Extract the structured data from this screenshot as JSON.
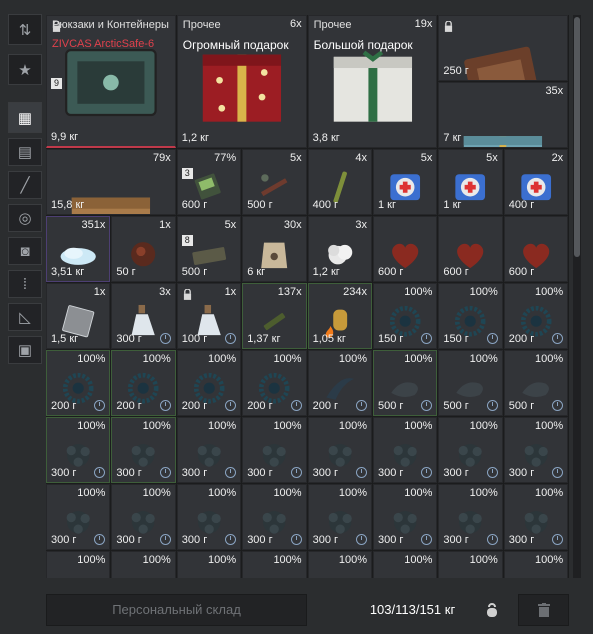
{
  "sidebar": {
    "items": [
      {
        "name": "sort-icon",
        "active": false
      },
      {
        "name": "favorite-star-icon",
        "active": false
      },
      {
        "name": "all-items-grid-icon",
        "active": true
      },
      {
        "name": "armor-icon",
        "active": false
      },
      {
        "name": "weapon-icon",
        "active": false
      },
      {
        "name": "grenade-icon",
        "active": false
      },
      {
        "name": "device-icon",
        "active": false
      },
      {
        "name": "ammo-icon",
        "active": false
      },
      {
        "name": "tools-icon",
        "active": false
      },
      {
        "name": "container-icon",
        "active": false
      }
    ]
  },
  "items": [
    {
      "col": 0,
      "row": 0,
      "w": 2,
      "h": 2,
      "cat": "Рюкзаки и Контейнеры",
      "name": "ZIVCAS ArcticSafe-6",
      "name_color": "red",
      "weight": "9,9 кг",
      "count": "",
      "badge": "9",
      "lock": true,
      "rare": true,
      "art": "safe"
    },
    {
      "col": 2,
      "row": 0,
      "w": 2,
      "h": 2,
      "cat": "Прочее",
      "name": "Огромный подарок",
      "weight": "1,2 кг",
      "count": "6x",
      "art": "gift-red"
    },
    {
      "col": 4,
      "row": 0,
      "w": 2,
      "h": 2,
      "cat": "Прочее",
      "name": "Большой подарок",
      "weight": "3,8 кг",
      "count": "19x",
      "art": "gift-white"
    },
    {
      "col": 6,
      "row": 0,
      "w": 2,
      "h": 1,
      "weight": "250 г",
      "count": "",
      "lock": true,
      "art": "case"
    },
    {
      "col": 6,
      "row": 1,
      "w": 2,
      "h": 1,
      "weight": "7 кг",
      "count": "35x",
      "art": "gift-blue"
    },
    {
      "col": 0,
      "row": 2,
      "w": 2,
      "h": 1,
      "weight": "15,8 кг",
      "count": "79x",
      "art": "box"
    },
    {
      "col": 2,
      "row": 2,
      "w": 1,
      "h": 1,
      "weight": "600 г",
      "count": "77%",
      "badge": "3",
      "art": "device"
    },
    {
      "col": 3,
      "row": 2,
      "w": 1,
      "h": 1,
      "weight": "500 г",
      "count": "5x",
      "art": "grenade"
    },
    {
      "col": 4,
      "row": 2,
      "w": 1,
      "h": 1,
      "weight": "400 г",
      "count": "4x",
      "art": "stick"
    },
    {
      "col": 5,
      "row": 2,
      "w": 1,
      "h": 1,
      "weight": "1 кг",
      "count": "5x",
      "art": "medkit"
    },
    {
      "col": 6,
      "row": 2,
      "w": 1,
      "h": 1,
      "weight": "1 кг",
      "count": "5x",
      "art": "medkit"
    },
    {
      "col": 7,
      "row": 2,
      "w": 1,
      "h": 1,
      "weight": "400 г",
      "count": "2x",
      "art": "medkit"
    },
    {
      "col": 0,
      "row": 3,
      "w": 1,
      "h": 1,
      "weight": "3,51 кг",
      "count": "351x",
      "art": "snow",
      "purple": true
    },
    {
      "col": 1,
      "row": 3,
      "w": 1,
      "h": 1,
      "weight": "50 г",
      "count": "1x",
      "art": "shard"
    },
    {
      "col": 2,
      "row": 3,
      "w": 1,
      "h": 1,
      "weight": "500 г",
      "count": "5x",
      "badge": "8",
      "art": "brick"
    },
    {
      "col": 3,
      "row": 3,
      "w": 1,
      "h": 1,
      "weight": "6 кг",
      "count": "30x",
      "art": "bag"
    },
    {
      "col": 4,
      "row": 3,
      "w": 1,
      "h": 1,
      "weight": "1,2 кг",
      "count": "3x",
      "art": "cloud"
    },
    {
      "col": 5,
      "row": 3,
      "w": 1,
      "h": 1,
      "weight": "600 г",
      "count": "",
      "art": "heart"
    },
    {
      "col": 6,
      "row": 3,
      "w": 1,
      "h": 1,
      "weight": "600 г",
      "count": "",
      "art": "heart"
    },
    {
      "col": 7,
      "row": 3,
      "w": 1,
      "h": 1,
      "weight": "600 г",
      "count": "",
      "art": "heart"
    },
    {
      "col": 0,
      "row": 4,
      "w": 1,
      "h": 1,
      "weight": "1,5 кг",
      "count": "1x",
      "art": "plate"
    },
    {
      "col": 1,
      "row": 4,
      "w": 1,
      "h": 1,
      "weight": "300 г",
      "count": "3x",
      "art": "bottle",
      "clock": true
    },
    {
      "col": 2,
      "row": 4,
      "w": 1,
      "h": 1,
      "weight": "100 г",
      "count": "1x",
      "art": "bottle",
      "lock": true,
      "clock": true
    },
    {
      "col": 3,
      "row": 4,
      "w": 1,
      "h": 1,
      "weight": "1,37 кг",
      "count": "137x",
      "art": "ammo",
      "green": true
    },
    {
      "col": 4,
      "row": 4,
      "w": 1,
      "h": 1,
      "weight": "1,05 кг",
      "count": "234x",
      "art": "ammo-fire",
      "green": true
    },
    {
      "col": 5,
      "row": 4,
      "w": 1,
      "h": 1,
      "weight": "150 г",
      "count": "100%",
      "art": "artifact",
      "clock": true
    },
    {
      "col": 6,
      "row": 4,
      "w": 1,
      "h": 1,
      "weight": "150 г",
      "count": "100%",
      "art": "artifact",
      "clock": true
    },
    {
      "col": 7,
      "row": 4,
      "w": 1,
      "h": 1,
      "weight": "200 г",
      "count": "100%",
      "art": "artifact",
      "clock": true
    },
    {
      "col": 0,
      "row": 5,
      "w": 1,
      "h": 1,
      "weight": "200 г",
      "count": "100%",
      "art": "artifact",
      "clock": true,
      "green": true
    },
    {
      "col": 1,
      "row": 5,
      "w": 1,
      "h": 1,
      "weight": "200 г",
      "count": "100%",
      "art": "artifact",
      "clock": true,
      "green": true
    },
    {
      "col": 2,
      "row": 5,
      "w": 1,
      "h": 1,
      "weight": "200 г",
      "count": "100%",
      "art": "artifact",
      "clock": true
    },
    {
      "col": 3,
      "row": 5,
      "w": 1,
      "h": 1,
      "weight": "200 г",
      "count": "100%",
      "art": "artifact",
      "clock": true
    },
    {
      "col": 4,
      "row": 5,
      "w": 1,
      "h": 1,
      "weight": "200 г",
      "count": "100%",
      "art": "claw",
      "clock": true
    },
    {
      "col": 5,
      "row": 5,
      "w": 1,
      "h": 1,
      "weight": "500 г",
      "count": "100%",
      "art": "dark",
      "clock": true,
      "green": true
    },
    {
      "col": 6,
      "row": 5,
      "w": 1,
      "h": 1,
      "weight": "500 г",
      "count": "100%",
      "art": "dark",
      "clock": true
    },
    {
      "col": 7,
      "row": 5,
      "w": 1,
      "h": 1,
      "weight": "500 г",
      "count": "100%",
      "art": "dark",
      "clock": true
    },
    {
      "col": 0,
      "row": 6,
      "w": 1,
      "h": 1,
      "weight": "300 г",
      "count": "100%",
      "art": "flower",
      "clock": true,
      "green": true
    },
    {
      "col": 1,
      "row": 6,
      "w": 1,
      "h": 1,
      "weight": "300 г",
      "count": "100%",
      "art": "flower",
      "clock": true,
      "green": true
    },
    {
      "col": 2,
      "row": 6,
      "w": 1,
      "h": 1,
      "weight": "300 г",
      "count": "100%",
      "art": "flower",
      "clock": true
    },
    {
      "col": 3,
      "row": 6,
      "w": 1,
      "h": 1,
      "weight": "300 г",
      "count": "100%",
      "art": "flower",
      "clock": true
    },
    {
      "col": 4,
      "row": 6,
      "w": 1,
      "h": 1,
      "weight": "300 г",
      "count": "100%",
      "art": "flower",
      "clock": true
    },
    {
      "col": 5,
      "row": 6,
      "w": 1,
      "h": 1,
      "weight": "300 г",
      "count": "100%",
      "art": "flower",
      "clock": true
    },
    {
      "col": 6,
      "row": 6,
      "w": 1,
      "h": 1,
      "weight": "300 г",
      "count": "100%",
      "art": "flower",
      "clock": true
    },
    {
      "col": 7,
      "row": 6,
      "w": 1,
      "h": 1,
      "weight": "300 г",
      "count": "100%",
      "art": "flower",
      "clock": true
    },
    {
      "col": 0,
      "row": 7,
      "w": 1,
      "h": 1,
      "weight": "300 г",
      "count": "100%",
      "art": "flower",
      "clock": true
    },
    {
      "col": 1,
      "row": 7,
      "w": 1,
      "h": 1,
      "weight": "300 г",
      "count": "100%",
      "art": "flower",
      "clock": true
    },
    {
      "col": 2,
      "row": 7,
      "w": 1,
      "h": 1,
      "weight": "300 г",
      "count": "100%",
      "art": "flower",
      "clock": true
    },
    {
      "col": 3,
      "row": 7,
      "w": 1,
      "h": 1,
      "weight": "300 г",
      "count": "100%",
      "art": "flower",
      "clock": true
    },
    {
      "col": 4,
      "row": 7,
      "w": 1,
      "h": 1,
      "weight": "300 г",
      "count": "100%",
      "art": "flower",
      "clock": true
    },
    {
      "col": 5,
      "row": 7,
      "w": 1,
      "h": 1,
      "weight": "300 г",
      "count": "100%",
      "art": "flower",
      "clock": true
    },
    {
      "col": 6,
      "row": 7,
      "w": 1,
      "h": 1,
      "weight": "300 г",
      "count": "100%",
      "art": "flower",
      "clock": true
    },
    {
      "col": 7,
      "row": 7,
      "w": 1,
      "h": 1,
      "weight": "300 г",
      "count": "100%",
      "art": "flower",
      "clock": true
    },
    {
      "col": 0,
      "row": 8,
      "w": 1,
      "h": 1,
      "weight": "",
      "count": "100%",
      "art": "flower"
    },
    {
      "col": 1,
      "row": 8,
      "w": 1,
      "h": 1,
      "weight": "",
      "count": "100%",
      "art": "flower"
    },
    {
      "col": 2,
      "row": 8,
      "w": 1,
      "h": 1,
      "weight": "",
      "count": "100%",
      "art": "flower"
    },
    {
      "col": 3,
      "row": 8,
      "w": 1,
      "h": 1,
      "weight": "",
      "count": "100%",
      "art": "flower"
    },
    {
      "col": 4,
      "row": 8,
      "w": 1,
      "h": 1,
      "weight": "",
      "count": "100%",
      "art": "flower"
    },
    {
      "col": 5,
      "row": 8,
      "w": 1,
      "h": 1,
      "weight": "",
      "count": "100%",
      "art": "flower"
    },
    {
      "col": 6,
      "row": 8,
      "w": 1,
      "h": 1,
      "weight": "",
      "count": "100%",
      "art": "flower"
    },
    {
      "col": 7,
      "row": 8,
      "w": 1,
      "h": 1,
      "weight": "",
      "count": "100%",
      "art": "flower"
    }
  ],
  "footer": {
    "storage_label": "Персональный склад",
    "weight_text": "103/113/151 кг",
    "weight_icon": "kettlebell-icon",
    "trash_icon": "trash-icon"
  }
}
